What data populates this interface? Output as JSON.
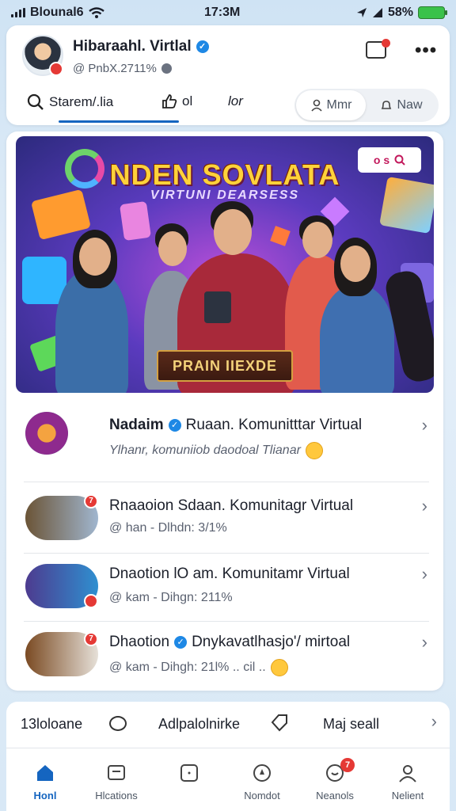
{
  "status_bar": {
    "carrier": "Blounal6",
    "time": "17:3M",
    "battery": "58%"
  },
  "profile": {
    "name": "Hibaraahl. Virtlal",
    "handle": "@ PnbX.2711%"
  },
  "tabs": {
    "search_label": "Starem/.lia",
    "like_label": "ol",
    "edit_label": "lor",
    "pill_active": "Mmr",
    "pill_plain": "Naw"
  },
  "banner": {
    "title": "NDEN SOVLATA",
    "subtitle": "VIRTUNI DEARSESS",
    "tag": "o s",
    "plaque": "PRAIN IIEXDE"
  },
  "feed": {
    "items": [
      {
        "title_lead": "Nadaim",
        "title_rest": "Ruaan. Komunitttar Virtual",
        "subtitle": "Ylhanr, komuniiob daodoal Tlianar"
      },
      {
        "title_lead": "Rnaaoion Sdaan. Komunitagr Virtual",
        "title_rest": "",
        "subtitle": "@ han - Dlhdn: 3/1%"
      },
      {
        "title_lead": "Dnaotion lO am. Komunitamr Virtual",
        "title_rest": "",
        "subtitle": "@ kam - Dihgn: 211%"
      },
      {
        "title_lead": "Dhaotion",
        "title_rest": "Dnykavatlhasjo'/ mirtoal",
        "subtitle": "@ kam - Dihgh: 21l% .. cil ..",
        "badge": "7"
      }
    ]
  },
  "actions": {
    "left": "13loloane",
    "middle": "Adlpalolnirke",
    "right": "Maj seall"
  },
  "bottom_nav": {
    "items": [
      "Honl",
      "Hlcations",
      "",
      "Nomdot",
      "Neanols",
      "Nelient"
    ],
    "badge": "7"
  },
  "colors": {
    "accent": "#1565c0",
    "badge": "#e53935",
    "banner_title": "#ffd23a"
  }
}
